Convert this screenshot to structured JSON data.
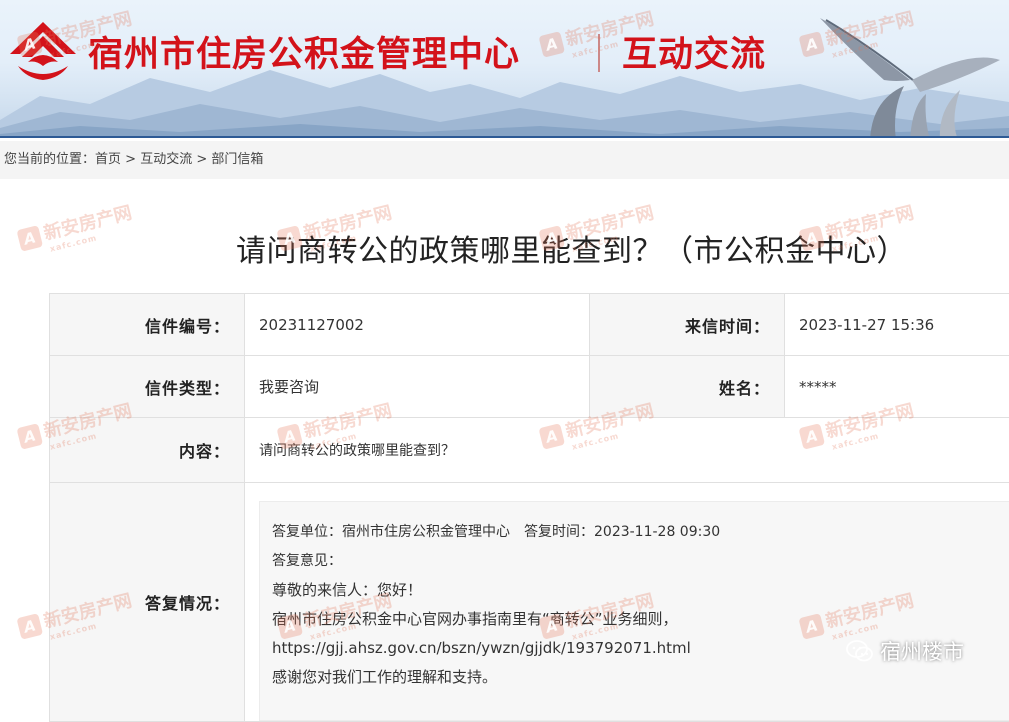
{
  "header": {
    "site_title": "宿州市住房公积金管理中心",
    "section_title": "互动交流"
  },
  "breadcrumb": {
    "prefix": "您当前的位置：",
    "items": [
      "首页",
      "互动交流",
      "部门信箱"
    ],
    "separator": " > "
  },
  "article": {
    "title": "请问商转公的政策哪里能查到？（市公积金中心）"
  },
  "detail": {
    "letter_no_label": "信件编号：",
    "letter_no": "20231127002",
    "time_label": "来信时间：",
    "time": "2023-11-27 15:36",
    "type_label": "信件类型：",
    "type": "我要咨询",
    "name_label": "姓名：",
    "name": "*****",
    "content_label": "内容：",
    "content": "请问商转公的政策哪里能查到？",
    "reply_label": "答复情况："
  },
  "reply": {
    "unit": "答复单位：宿州市住房公积金管理中心",
    "time": "答复时间：2023-11-28 09:30",
    "opinion_label": "答复意见：",
    "lines": [
      "尊敬的来信人：您好！",
      "宿州市住房公积金中心官网办事指南里有“商转公”业务细则，",
      "https://gjj.ahsz.gov.cn/bszn/ywzn/gjjdk/193792071.html",
      "感谢您对我们工作的理解和支持。"
    ]
  },
  "watermark": {
    "badge": "A",
    "text": "新安房产网",
    "sub": "xafc.com"
  },
  "source_tag": {
    "icon": "wechat-icon",
    "text": "宿州楼市"
  },
  "colors": {
    "brand_red": "#d3121a",
    "banner_line": "#2d5a95"
  }
}
